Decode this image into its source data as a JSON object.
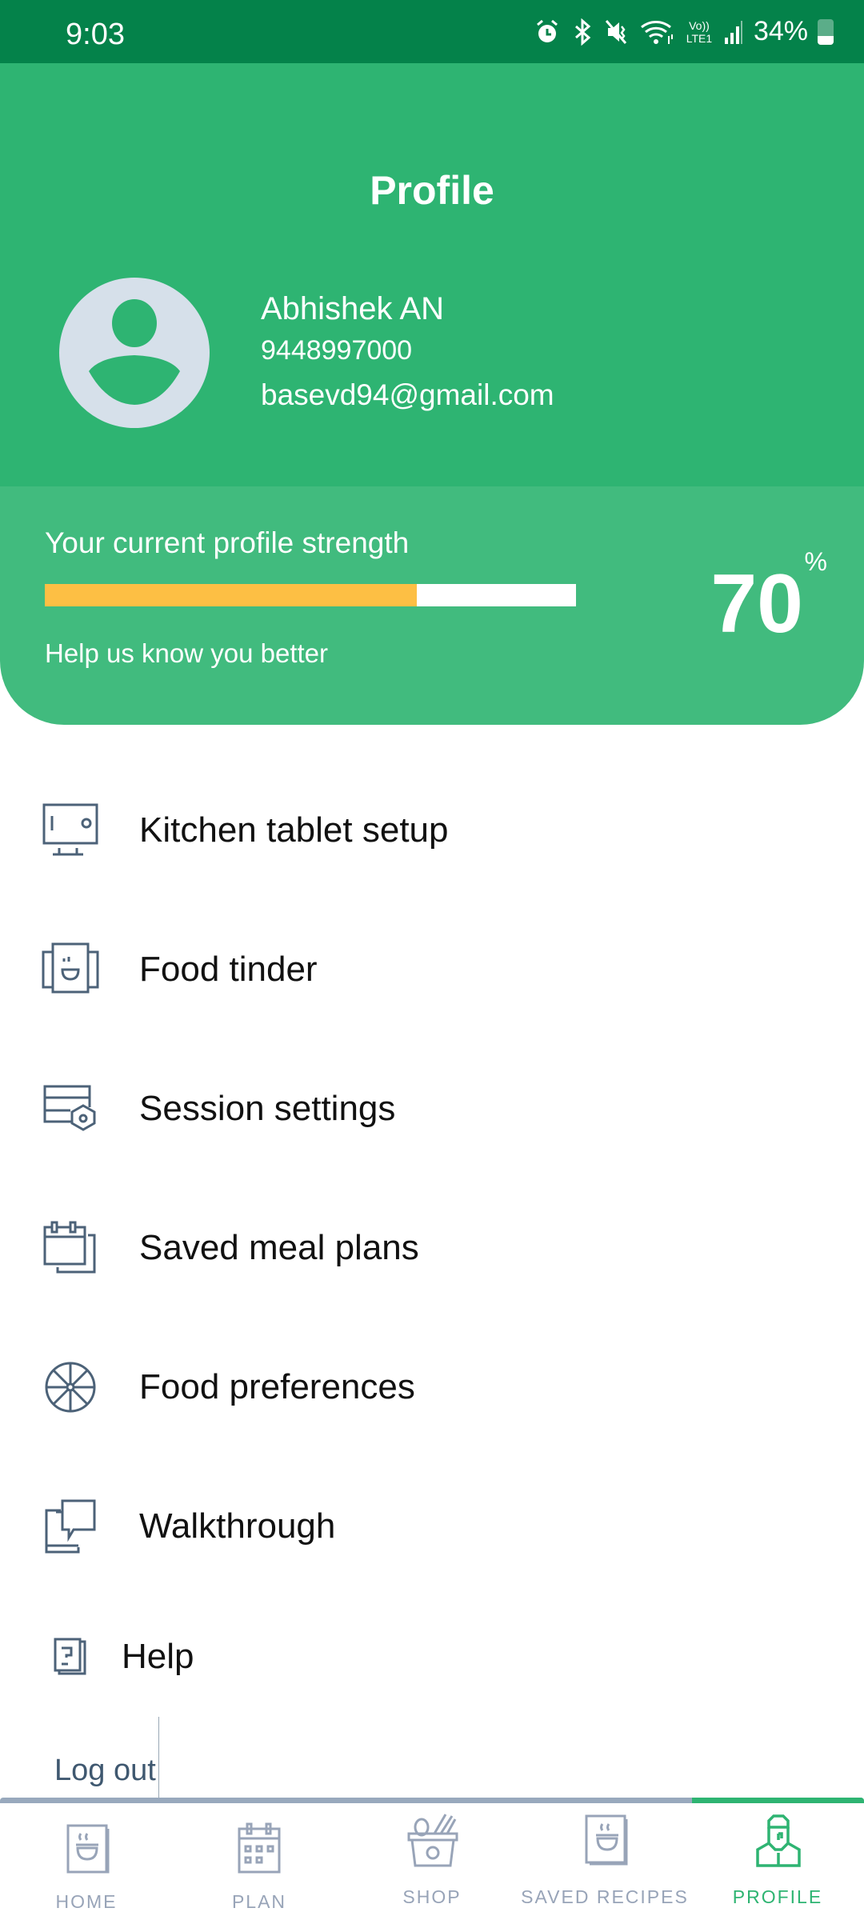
{
  "status_bar": {
    "time": "9:03",
    "icons": [
      "alarm-icon",
      "bluetooth-icon",
      "mute-icon",
      "wifi-icon",
      "volte-lte-icon",
      "signal-icon"
    ],
    "volte_label": "Vo)) LTE1",
    "battery": "34%",
    "battery_level": 0.34
  },
  "header": {
    "title": "Profile",
    "user": {
      "name": "Abhishek AN",
      "phone": "9448997000",
      "email": "basevd94@gmail.com"
    }
  },
  "profile_strength": {
    "label": "Your current profile strength",
    "subtitle": "Help us know you better",
    "percent": 70,
    "percent_value": "70",
    "percent_sign": "%",
    "colors": {
      "fill": "#fdbf44",
      "track": "#ffffff"
    }
  },
  "menu": {
    "items": [
      {
        "label": "Kitchen tablet setup",
        "icon": "kitchen-tablet-icon"
      },
      {
        "label": "Food tinder",
        "icon": "food-tinder-icon"
      },
      {
        "label": "Session settings",
        "icon": "session-settings-icon"
      },
      {
        "label": "Saved meal plans",
        "icon": "saved-meal-plans-icon"
      },
      {
        "label": "Food preferences",
        "icon": "food-preferences-icon"
      },
      {
        "label": "Walkthrough",
        "icon": "walkthrough-icon"
      },
      {
        "label": "Help",
        "icon": "help-icon"
      }
    ],
    "logout": "Log out"
  },
  "bottom_nav": {
    "items": [
      {
        "label": "HOME",
        "icon": "home-icon",
        "active": false
      },
      {
        "label": "PLAN",
        "icon": "plan-calendar-icon",
        "active": false
      },
      {
        "label": "SHOP",
        "icon": "shop-basket-icon",
        "active": false
      },
      {
        "label": "SAVED RECIPES",
        "icon": "saved-recipes-icon",
        "active": false
      },
      {
        "label": "PROFILE",
        "icon": "profile-chef-icon",
        "active": true
      }
    ]
  },
  "colors": {
    "status_bar": "#04824a",
    "header": "#2eb472",
    "strength_card": "#41bb7e",
    "accent": "#2eb472",
    "icon_stroke": "#4c6278",
    "nav_inactive": "#98a4b8"
  }
}
